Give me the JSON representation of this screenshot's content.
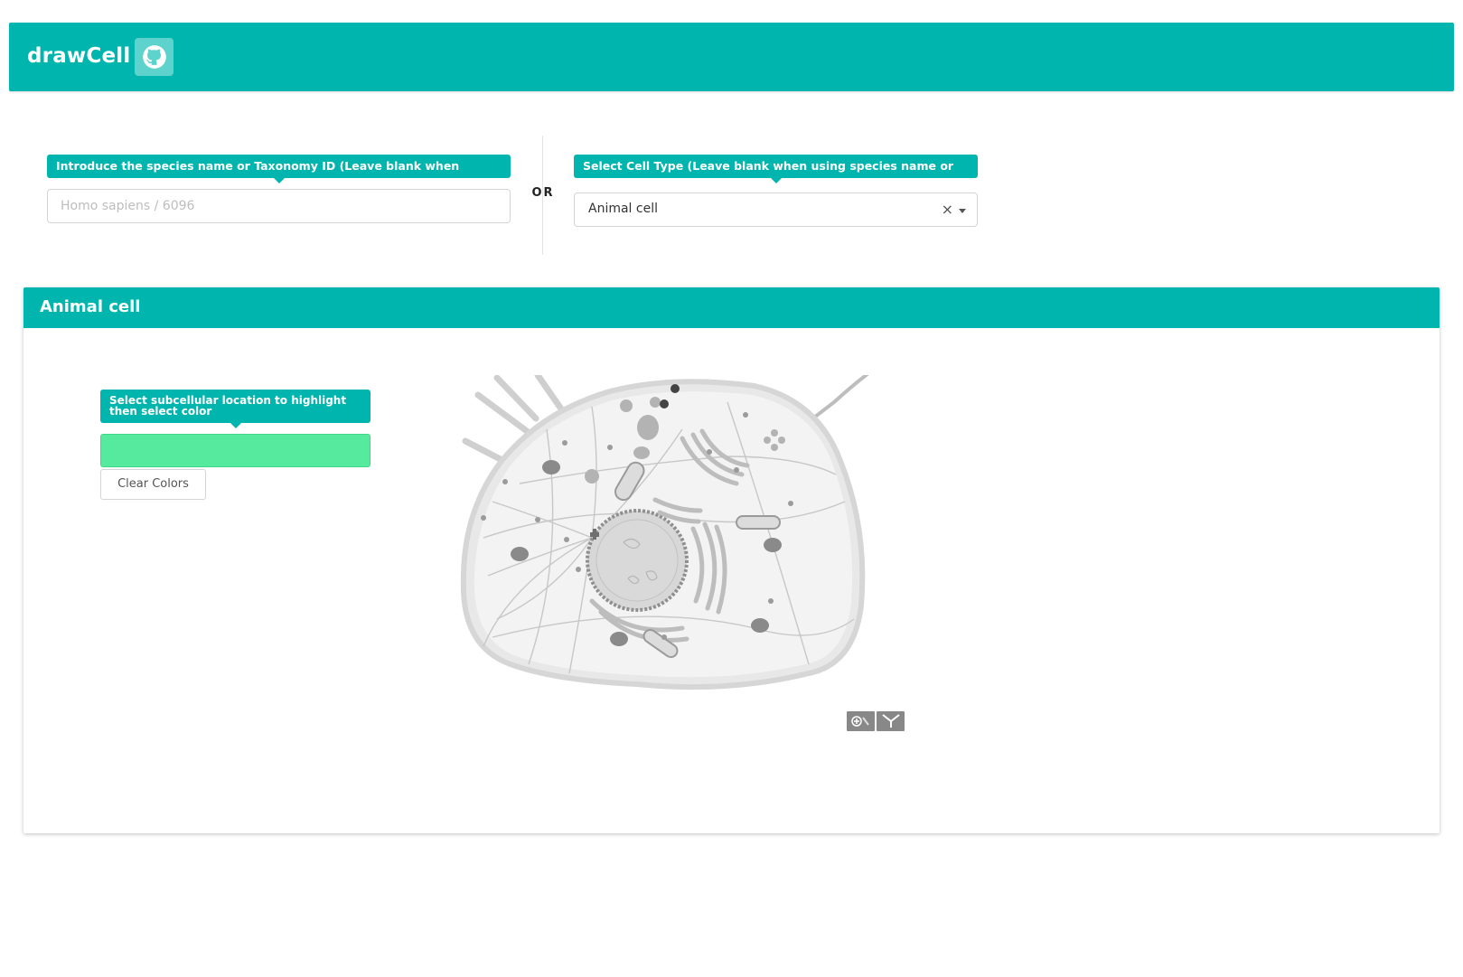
{
  "header": {
    "brand": "drawCell",
    "github_icon": "github-icon"
  },
  "species": {
    "tooltip": "Introduce the species name or Taxonomy ID (Leave blank when selecting cell type)",
    "placeholder": "Homo sapiens / 6096",
    "value": ""
  },
  "separator": {
    "label": "OR"
  },
  "celltype": {
    "tooltip": "Select Cell Type (Leave blank when using species name or taxonomy ID)",
    "selected": "Animal cell",
    "clear_glyph": "×"
  },
  "panel": {
    "title": "Animal cell",
    "subcell_tooltip": "Select subcellular location to highlight then select color",
    "selected_color": "#56ea9e",
    "clear_button": "Clear Colors"
  },
  "colors": {
    "accent": "#00b5ad",
    "highlight": "#56ea9e"
  }
}
